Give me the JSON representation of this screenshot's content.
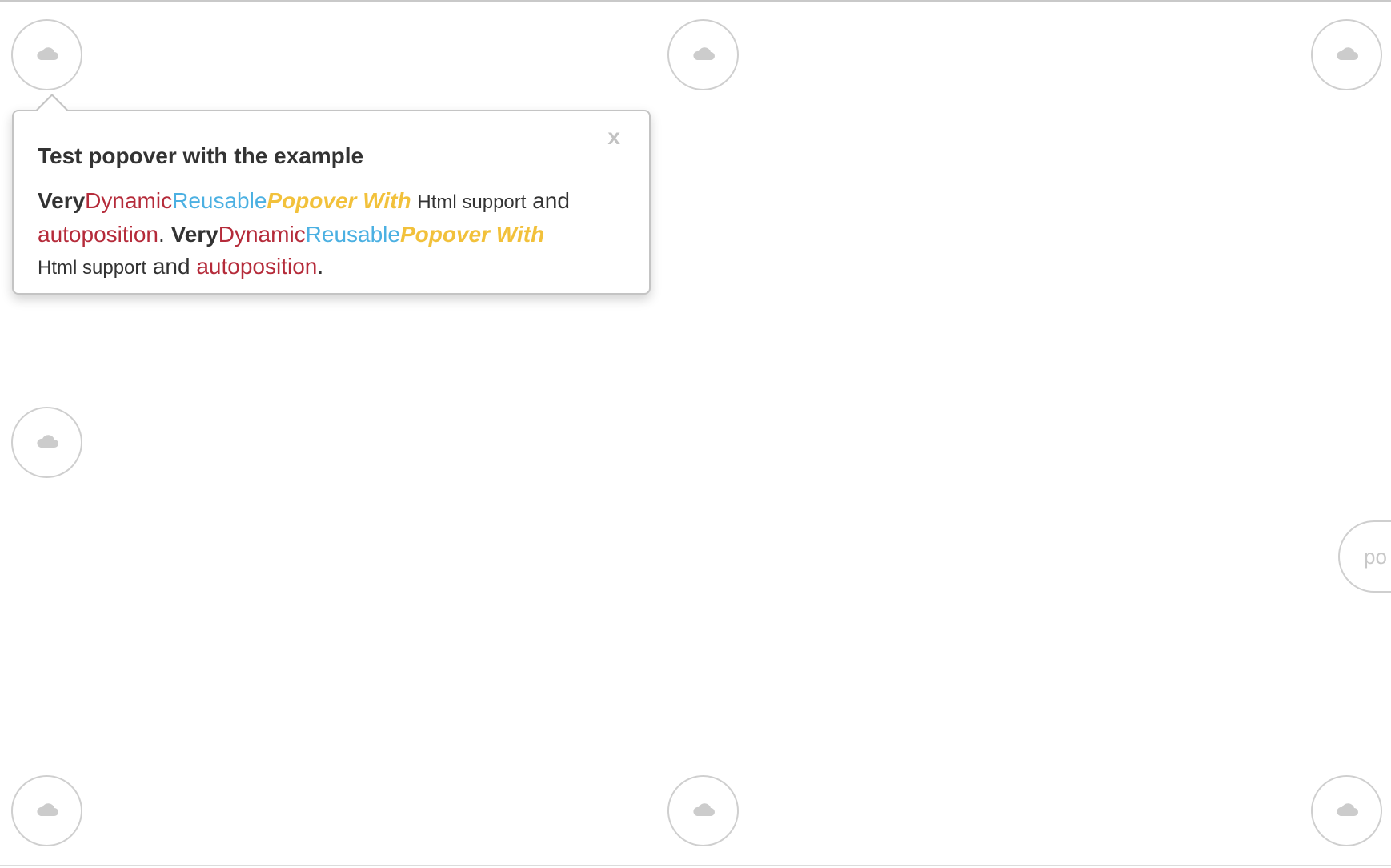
{
  "popover": {
    "title": "Test popover with the example",
    "close_label": "x",
    "content": {
      "line1": {
        "very": "Very",
        "dynamic": "Dynamic",
        "reusable": "Reusable",
        "popover_with": "Popover With",
        "html_support": "Html support",
        "and": "and"
      },
      "line2": {
        "autoposition": "autoposition",
        "period": ".",
        "very": "Very",
        "dynamic": "Dynamic",
        "reusable": "Reusable",
        "popover_with": "Popover With"
      },
      "line3": {
        "html_support": "Html support",
        "and": "and",
        "autoposition": "autoposition",
        "period": "."
      }
    }
  },
  "triggers": {
    "icon": "cloud-icon",
    "pill_label": "po"
  },
  "colors": {
    "red": "#b52b3a",
    "blue": "#4bb0e2",
    "yellow": "#f2c13b",
    "text": "#333333",
    "border": "#cfcfcf",
    "icon": "#cccccc"
  }
}
